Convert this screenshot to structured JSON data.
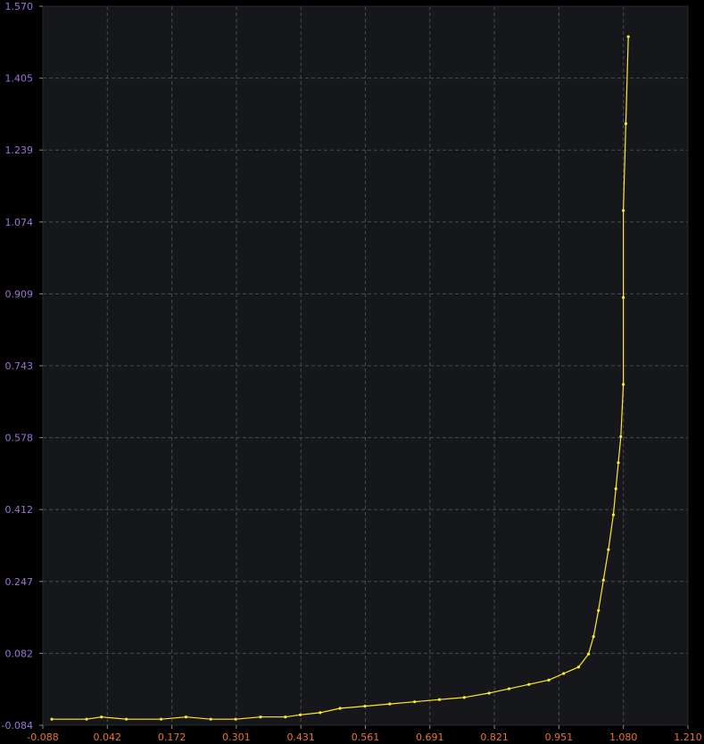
{
  "chart_data": {
    "type": "line",
    "title": "",
    "xlabel": "",
    "ylabel": "",
    "xlim": [
      -0.088,
      1.21
    ],
    "ylim": [
      -0.084,
      1.57
    ],
    "x_ticks": [
      "-0.088",
      "0.042",
      "0.172",
      "0.301",
      "0.431",
      "0.561",
      "0.691",
      "0.821",
      "0.951",
      "1.080",
      "1.210"
    ],
    "y_ticks": [
      "-0.084",
      "0.082",
      "0.247",
      "0.412",
      "0.578",
      "0.743",
      "0.909",
      "1.074",
      "1.239",
      "1.405",
      "1.570"
    ],
    "grid": true,
    "colors": {
      "background": "#16171a",
      "frame": "#000000",
      "grid": "#4a4a4a",
      "line": "#ffea2a",
      "x_tick_labels": "#e8742f",
      "y_tick_labels": "#9a74d8"
    },
    "series": [
      {
        "x": [
          -0.07,
          0.0,
          0.03,
          0.08,
          0.15,
          0.2,
          0.25,
          0.3,
          0.35,
          0.4,
          0.43,
          0.47,
          0.51,
          0.56,
          0.61,
          0.66,
          0.71,
          0.76,
          0.81,
          0.85,
          0.89,
          0.93,
          0.96,
          0.99,
          1.01,
          1.02,
          1.03,
          1.04,
          1.05,
          1.06,
          1.065,
          1.07,
          1.075,
          1.08,
          1.08,
          1.08,
          1.085,
          1.09
        ],
        "y": [
          -0.07,
          -0.07,
          -0.065,
          -0.07,
          -0.07,
          -0.065,
          -0.07,
          -0.07,
          -0.065,
          -0.065,
          -0.06,
          -0.055,
          -0.045,
          -0.04,
          -0.035,
          -0.03,
          -0.025,
          -0.02,
          -0.01,
          0.0,
          0.01,
          0.02,
          0.035,
          0.05,
          0.08,
          0.12,
          0.18,
          0.25,
          0.32,
          0.4,
          0.46,
          0.52,
          0.58,
          0.7,
          0.9,
          1.1,
          1.3,
          1.5
        ]
      }
    ]
  }
}
